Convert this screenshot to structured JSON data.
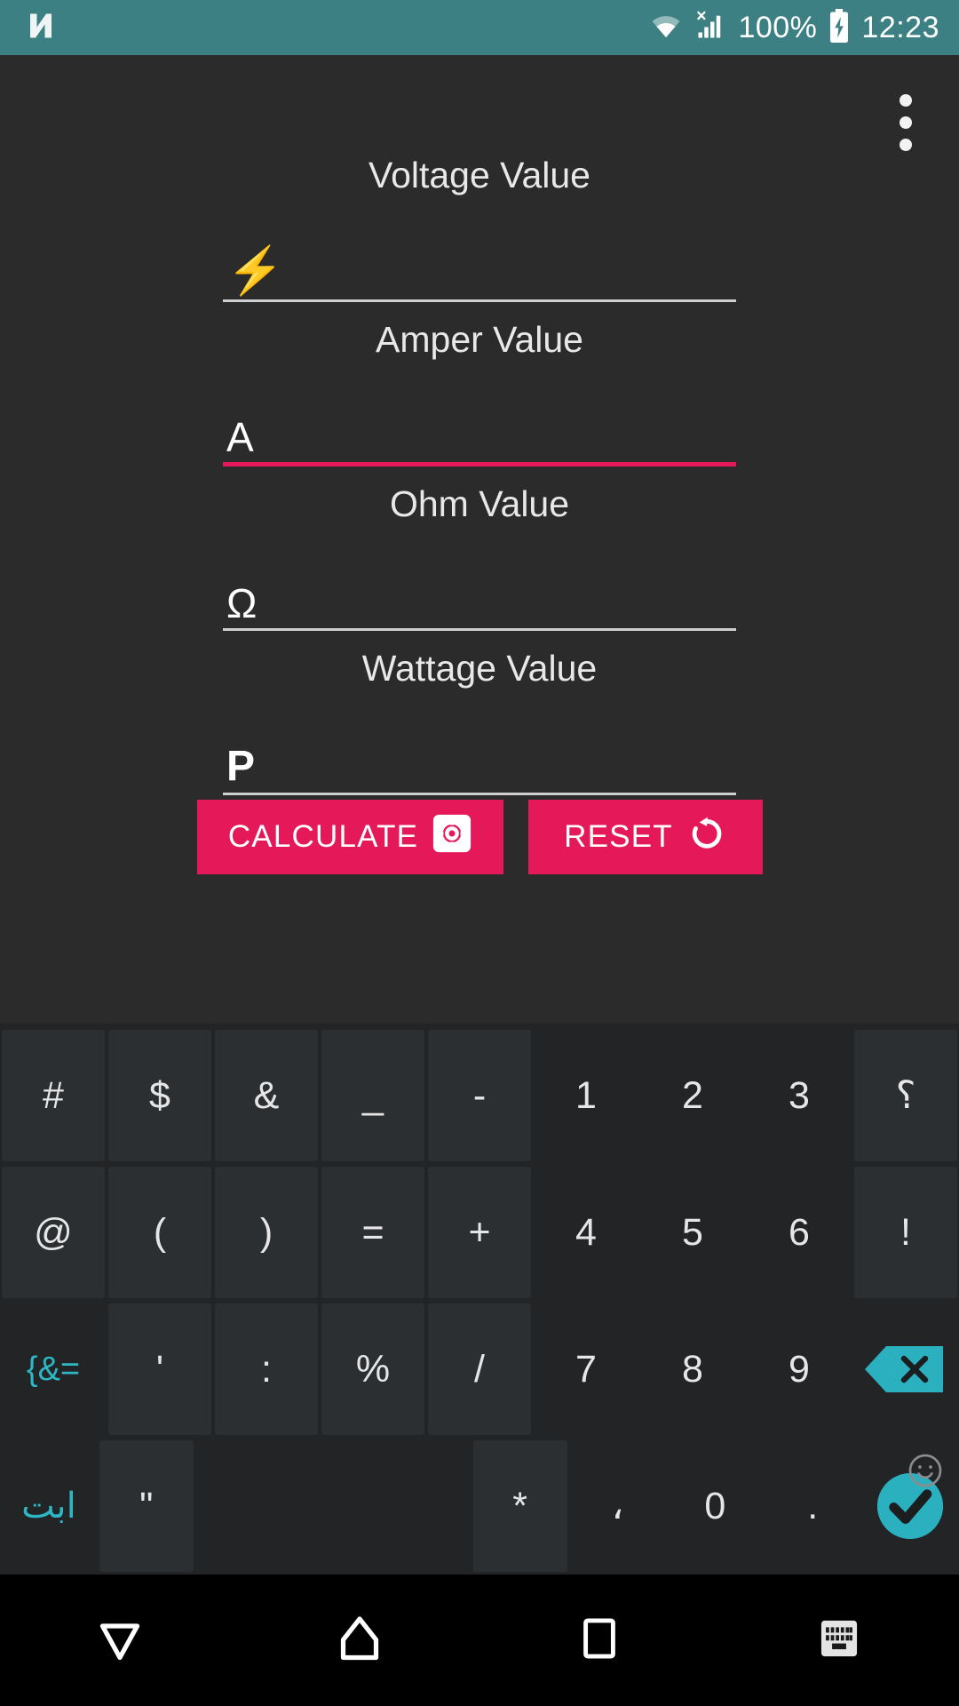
{
  "status_bar": {
    "bg_color": "#3C8084",
    "notification_icon": "n-logo-icon",
    "wifi_icon": "wifi-icon",
    "signal_icon": "cellular-signal-no-sim-icon",
    "battery_text": "100%",
    "battery_icon": "battery-charging-icon",
    "time": "12:23"
  },
  "app": {
    "bg_color": "#2B2B2B",
    "accent_color": "#E5185A",
    "overflow_menu": "overflow-menu",
    "fields": [
      {
        "label": "Voltage Value",
        "value": "⚡",
        "icon_name": "lightning-bolt-icon",
        "focused": false
      },
      {
        "label": "Amper Value",
        "value": "A",
        "icon_name": "ampere-letter",
        "focused": true
      },
      {
        "label": "Ohm Value",
        "value": "Ω",
        "icon_name": "omega-letter",
        "focused": false
      },
      {
        "label": "Wattage Value",
        "value": "P",
        "icon_name": "power-letter",
        "focused": false
      }
    ],
    "buttons": {
      "calculate_label": "CALCULATE",
      "calculate_icon": "gear-icon",
      "reset_label": "RESET",
      "reset_icon": "undo-rotate-icon"
    }
  },
  "keyboard": {
    "bg_color": "#222426",
    "key_color": "#2C2F31",
    "teal_color": "#2DB6C4",
    "rows": [
      [
        {
          "label": "#",
          "name": "key-hash",
          "style": "key"
        },
        {
          "label": "$",
          "name": "key-dollar",
          "style": "key"
        },
        {
          "label": "&",
          "name": "key-ampersand",
          "style": "key"
        },
        {
          "label": "_",
          "name": "key-underscore",
          "style": "key"
        },
        {
          "label": "-",
          "name": "key-hyphen",
          "style": "key"
        },
        {
          "label": "1",
          "name": "key-1",
          "style": "flat"
        },
        {
          "label": "2",
          "name": "key-2",
          "style": "flat"
        },
        {
          "label": "3",
          "name": "key-3",
          "style": "flat"
        },
        {
          "label": "؟",
          "name": "key-arabic-question-mark",
          "style": "key"
        }
      ],
      [
        {
          "label": "@",
          "name": "key-at",
          "style": "key"
        },
        {
          "label": "(",
          "name": "key-paren-open",
          "style": "key"
        },
        {
          "label": ")",
          "name": "key-paren-close",
          "style": "key"
        },
        {
          "label": "=",
          "name": "key-equals",
          "style": "key"
        },
        {
          "label": "+",
          "name": "key-plus",
          "style": "key"
        },
        {
          "label": "4",
          "name": "key-4",
          "style": "flat"
        },
        {
          "label": "5",
          "name": "key-5",
          "style": "flat"
        },
        {
          "label": "6",
          "name": "key-6",
          "style": "flat"
        },
        {
          "label": "!",
          "name": "key-exclamation",
          "style": "key"
        }
      ],
      [
        {
          "label": "{&=",
          "name": "key-symbols-toggle",
          "style": "teal"
        },
        {
          "label": "'",
          "name": "key-apostrophe",
          "style": "key"
        },
        {
          "label": ":",
          "name": "key-colon",
          "style": "key"
        },
        {
          "label": "%",
          "name": "key-percent",
          "style": "key"
        },
        {
          "label": "/",
          "name": "key-slash",
          "style": "key"
        },
        {
          "label": "7",
          "name": "key-7",
          "style": "flat"
        },
        {
          "label": "8",
          "name": "key-8",
          "style": "flat"
        },
        {
          "label": "9",
          "name": "key-9",
          "style": "flat"
        },
        {
          "label": "",
          "name": "key-backspace",
          "style": "backspace"
        }
      ],
      [
        {
          "label": "ابت",
          "name": "key-arabic-letters-toggle",
          "style": "teal"
        },
        {
          "label": "\"",
          "name": "key-quote",
          "style": "key"
        },
        {
          "label": "",
          "name": "key-space",
          "style": "space"
        },
        {
          "label": "*",
          "name": "key-asterisk",
          "style": "key"
        },
        {
          "label": "،",
          "name": "key-arabic-comma",
          "style": "flat"
        },
        {
          "label": "0",
          "name": "key-0",
          "style": "flat"
        },
        {
          "label": ".",
          "name": "key-period",
          "style": "flat"
        },
        {
          "label": "",
          "name": "key-enter",
          "style": "enter"
        }
      ]
    ],
    "emoji_icon": "smiley-emoji-icon"
  },
  "nav_bar": {
    "bg_color": "#000000",
    "items": [
      {
        "name": "nav-back-button",
        "icon": "back-triangle-icon"
      },
      {
        "name": "nav-home-button",
        "icon": "home-icon"
      },
      {
        "name": "nav-recents-button",
        "icon": "recents-square-icon"
      },
      {
        "name": "nav-keyboard-toggle-button",
        "icon": "keyboard-icon"
      }
    ]
  }
}
